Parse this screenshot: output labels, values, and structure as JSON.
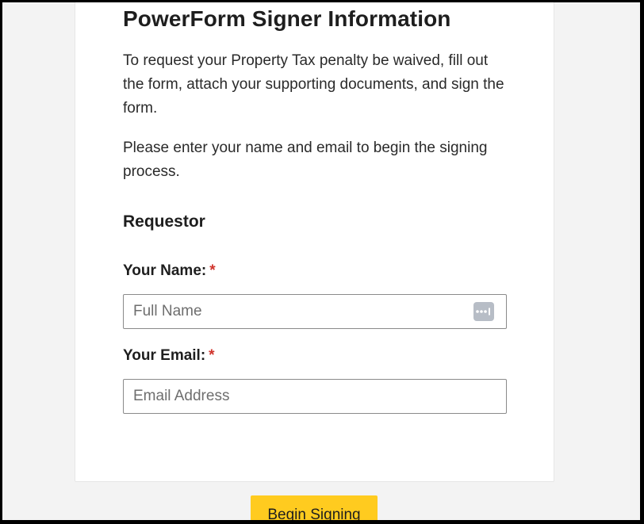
{
  "form": {
    "title": "PowerForm Signer Information",
    "intro": "To request your Property Tax penalty be waived, fill out the form, attach your supporting documents, and sign the form.",
    "instructions": "Please enter your name and email to begin the signing process.",
    "section_title": "Requestor",
    "name_field": {
      "label": "Your Name:",
      "required_marker": "*",
      "placeholder": "Full Name",
      "value": ""
    },
    "email_field": {
      "label": "Your Email:",
      "required_marker": "*",
      "placeholder": "Email Address",
      "value": ""
    },
    "password_manager_icon": "password-manager-icon"
  },
  "actions": {
    "begin_label": "Begin Signing"
  },
  "colors": {
    "accent": "#ffcb1f",
    "required": "#d0342c",
    "page_background": "#f3f3f3"
  }
}
